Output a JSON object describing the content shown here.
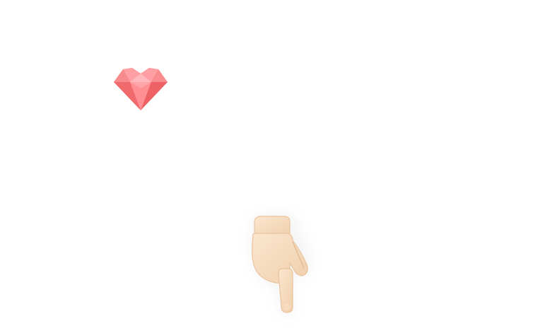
{
  "scene": {
    "background": "#ffffff",
    "items": [
      {
        "icon": "heart-gem-icon",
        "color": "#f5787a"
      },
      {
        "icon": "pointing-down-hand-icon",
        "color": "#f6dcc0"
      }
    ]
  }
}
